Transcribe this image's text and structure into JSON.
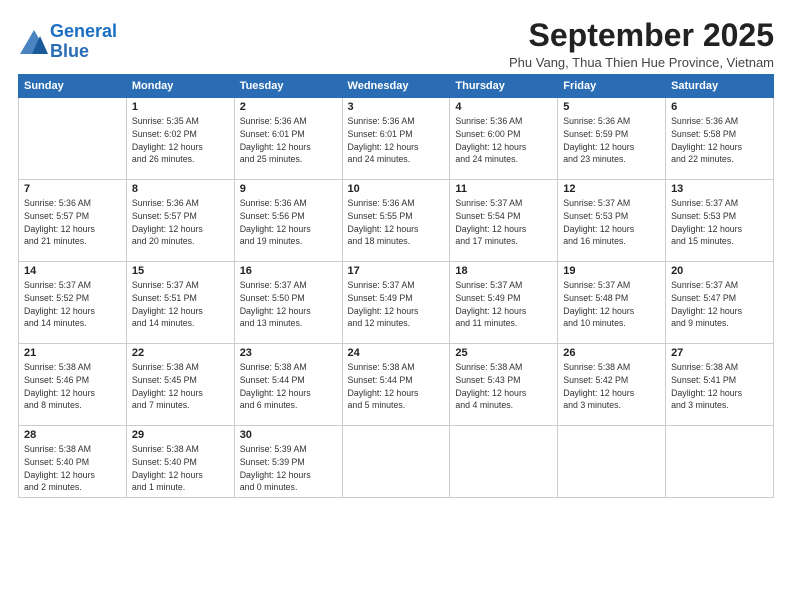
{
  "header": {
    "logo_line1": "General",
    "logo_line2": "Blue",
    "month": "September 2025",
    "location": "Phu Vang, Thua Thien Hue Province, Vietnam"
  },
  "weekdays": [
    "Sunday",
    "Monday",
    "Tuesday",
    "Wednesday",
    "Thursday",
    "Friday",
    "Saturday"
  ],
  "weeks": [
    [
      {
        "day": "",
        "info": ""
      },
      {
        "day": "1",
        "info": "Sunrise: 5:35 AM\nSunset: 6:02 PM\nDaylight: 12 hours\nand 26 minutes."
      },
      {
        "day": "2",
        "info": "Sunrise: 5:36 AM\nSunset: 6:01 PM\nDaylight: 12 hours\nand 25 minutes."
      },
      {
        "day": "3",
        "info": "Sunrise: 5:36 AM\nSunset: 6:01 PM\nDaylight: 12 hours\nand 24 minutes."
      },
      {
        "day": "4",
        "info": "Sunrise: 5:36 AM\nSunset: 6:00 PM\nDaylight: 12 hours\nand 24 minutes."
      },
      {
        "day": "5",
        "info": "Sunrise: 5:36 AM\nSunset: 5:59 PM\nDaylight: 12 hours\nand 23 minutes."
      },
      {
        "day": "6",
        "info": "Sunrise: 5:36 AM\nSunset: 5:58 PM\nDaylight: 12 hours\nand 22 minutes."
      }
    ],
    [
      {
        "day": "7",
        "info": "Sunrise: 5:36 AM\nSunset: 5:57 PM\nDaylight: 12 hours\nand 21 minutes."
      },
      {
        "day": "8",
        "info": "Sunrise: 5:36 AM\nSunset: 5:57 PM\nDaylight: 12 hours\nand 20 minutes."
      },
      {
        "day": "9",
        "info": "Sunrise: 5:36 AM\nSunset: 5:56 PM\nDaylight: 12 hours\nand 19 minutes."
      },
      {
        "day": "10",
        "info": "Sunrise: 5:36 AM\nSunset: 5:55 PM\nDaylight: 12 hours\nand 18 minutes."
      },
      {
        "day": "11",
        "info": "Sunrise: 5:37 AM\nSunset: 5:54 PM\nDaylight: 12 hours\nand 17 minutes."
      },
      {
        "day": "12",
        "info": "Sunrise: 5:37 AM\nSunset: 5:53 PM\nDaylight: 12 hours\nand 16 minutes."
      },
      {
        "day": "13",
        "info": "Sunrise: 5:37 AM\nSunset: 5:53 PM\nDaylight: 12 hours\nand 15 minutes."
      }
    ],
    [
      {
        "day": "14",
        "info": "Sunrise: 5:37 AM\nSunset: 5:52 PM\nDaylight: 12 hours\nand 14 minutes."
      },
      {
        "day": "15",
        "info": "Sunrise: 5:37 AM\nSunset: 5:51 PM\nDaylight: 12 hours\nand 14 minutes."
      },
      {
        "day": "16",
        "info": "Sunrise: 5:37 AM\nSunset: 5:50 PM\nDaylight: 12 hours\nand 13 minutes."
      },
      {
        "day": "17",
        "info": "Sunrise: 5:37 AM\nSunset: 5:49 PM\nDaylight: 12 hours\nand 12 minutes."
      },
      {
        "day": "18",
        "info": "Sunrise: 5:37 AM\nSunset: 5:49 PM\nDaylight: 12 hours\nand 11 minutes."
      },
      {
        "day": "19",
        "info": "Sunrise: 5:37 AM\nSunset: 5:48 PM\nDaylight: 12 hours\nand 10 minutes."
      },
      {
        "day": "20",
        "info": "Sunrise: 5:37 AM\nSunset: 5:47 PM\nDaylight: 12 hours\nand 9 minutes."
      }
    ],
    [
      {
        "day": "21",
        "info": "Sunrise: 5:38 AM\nSunset: 5:46 PM\nDaylight: 12 hours\nand 8 minutes."
      },
      {
        "day": "22",
        "info": "Sunrise: 5:38 AM\nSunset: 5:45 PM\nDaylight: 12 hours\nand 7 minutes."
      },
      {
        "day": "23",
        "info": "Sunrise: 5:38 AM\nSunset: 5:44 PM\nDaylight: 12 hours\nand 6 minutes."
      },
      {
        "day": "24",
        "info": "Sunrise: 5:38 AM\nSunset: 5:44 PM\nDaylight: 12 hours\nand 5 minutes."
      },
      {
        "day": "25",
        "info": "Sunrise: 5:38 AM\nSunset: 5:43 PM\nDaylight: 12 hours\nand 4 minutes."
      },
      {
        "day": "26",
        "info": "Sunrise: 5:38 AM\nSunset: 5:42 PM\nDaylight: 12 hours\nand 3 minutes."
      },
      {
        "day": "27",
        "info": "Sunrise: 5:38 AM\nSunset: 5:41 PM\nDaylight: 12 hours\nand 3 minutes."
      }
    ],
    [
      {
        "day": "28",
        "info": "Sunrise: 5:38 AM\nSunset: 5:40 PM\nDaylight: 12 hours\nand 2 minutes."
      },
      {
        "day": "29",
        "info": "Sunrise: 5:38 AM\nSunset: 5:40 PM\nDaylight: 12 hours\nand 1 minute."
      },
      {
        "day": "30",
        "info": "Sunrise: 5:39 AM\nSunset: 5:39 PM\nDaylight: 12 hours\nand 0 minutes."
      },
      {
        "day": "",
        "info": ""
      },
      {
        "day": "",
        "info": ""
      },
      {
        "day": "",
        "info": ""
      },
      {
        "day": "",
        "info": ""
      }
    ]
  ]
}
